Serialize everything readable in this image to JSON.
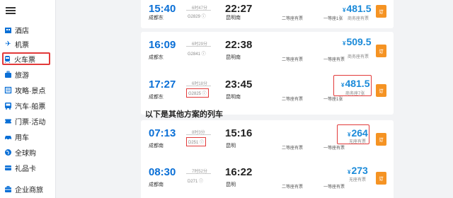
{
  "sidebar": {
    "items": [
      {
        "label": "酒店",
        "icon": "hotel-icon"
      },
      {
        "label": "机票",
        "icon": "airplane-icon"
      },
      {
        "label": "火车票",
        "icon": "train-icon",
        "active": true
      },
      {
        "label": "旅游",
        "icon": "suitcase-icon"
      },
      {
        "label": "攻略·景点",
        "icon": "guide-icon"
      },
      {
        "label": "汽车·船票",
        "icon": "bus-icon"
      },
      {
        "label": "门票·活动",
        "icon": "ticket-icon"
      },
      {
        "label": "用车",
        "icon": "car-icon"
      },
      {
        "label": "全球购",
        "icon": "globe-icon"
      },
      {
        "label": "礼品卡",
        "icon": "giftcard-icon"
      },
      {
        "label": "企业商旅",
        "icon": "briefcase-icon"
      }
    ]
  },
  "section_title": "以下是其他方案的列车",
  "trains": [
    {
      "dep_time": "15:40",
      "dep_station": "成都东",
      "arr_time": "22:27",
      "arr_station": "昆明南",
      "duration": "6时47分",
      "train_no": "G2829 ⓘ",
      "seat1": "二等座有票",
      "seat2": "一等座1张",
      "price": "481.5",
      "currency": "¥",
      "ticket_info": "商务座有票",
      "button": "订"
    },
    {
      "dep_time": "16:09",
      "dep_station": "成都东",
      "arr_time": "22:38",
      "arr_station": "昆明南",
      "duration": "6时29分",
      "train_no": "G2841 ⓘ",
      "seat1": "二等座有票",
      "seat2": "一等座有票",
      "price": "509.5",
      "currency": "¥",
      "ticket_info": "商务座有票",
      "button": "订"
    },
    {
      "dep_time": "17:27",
      "dep_station": "成都东",
      "arr_time": "23:45",
      "arr_station": "昆明南",
      "duration": "6时18分",
      "train_no": "G2825 ⓘ",
      "seat1": "二等座有票",
      "seat2": "一等座1张",
      "price": "481.5",
      "currency": "¥",
      "ticket_info": "商务座7张",
      "button": "订",
      "highlight": true
    },
    {
      "dep_time": "07:13",
      "dep_station": "成都南",
      "arr_time": "15:16",
      "arr_station": "昆明",
      "duration": "8时3分",
      "train_no": "D251 ⓘ",
      "seat1": "二等座有票",
      "seat2": "一等座有票",
      "price": "264",
      "currency": "¥",
      "ticket_info": "无座有票",
      "button": "订",
      "highlight": true
    },
    {
      "dep_time": "08:30",
      "dep_station": "成都南",
      "arr_time": "16:22",
      "arr_station": "昆明",
      "duration": "7时52分",
      "train_no": "D271 ⓘ",
      "seat1": "二等座有票",
      "seat2": "一等座有票",
      "price": "273",
      "currency": "¥",
      "ticket_info": "无座有票",
      "button": "订"
    }
  ]
}
